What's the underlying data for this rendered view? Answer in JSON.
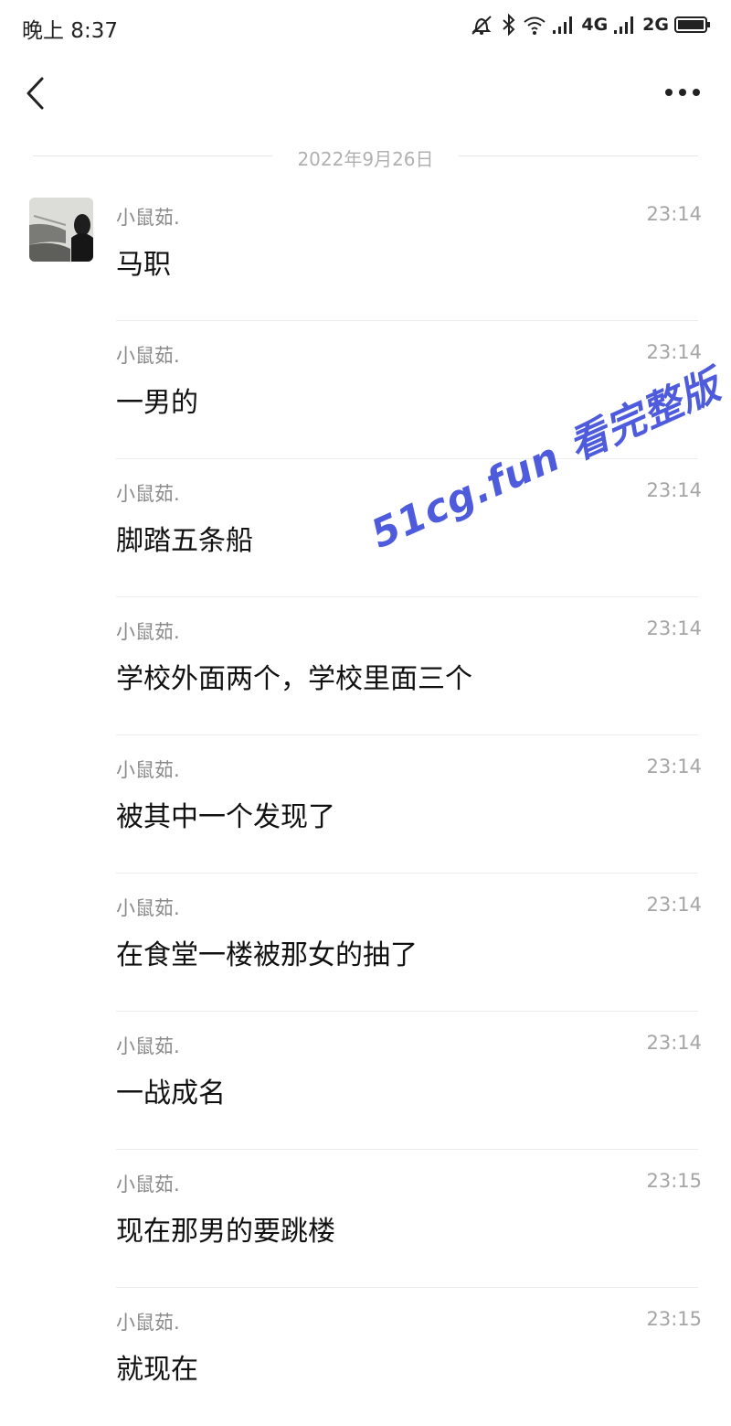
{
  "status_bar": {
    "time": "晚上 8:37",
    "network_1": "4G",
    "network_2": "2G",
    "icons": [
      "mute-icon",
      "bluetooth-icon",
      "wifi-icon",
      "signal-icon",
      "signal-icon",
      "battery-icon"
    ]
  },
  "nav": {
    "back_icon": "chevron-left-icon",
    "more_icon": "more-dots-icon"
  },
  "date_divider": "2022年9月26日",
  "messages": [
    {
      "sender": "小鼠茹.",
      "time": "23:14",
      "text": "马职"
    },
    {
      "sender": "小鼠茹.",
      "time": "23:14",
      "text": "一男的"
    },
    {
      "sender": "小鼠茹.",
      "time": "23:14",
      "text": "脚踏五条船"
    },
    {
      "sender": "小鼠茹.",
      "time": "23:14",
      "text": "学校外面两个，学校里面三个"
    },
    {
      "sender": "小鼠茹.",
      "time": "23:14",
      "text": "被其中一个发现了"
    },
    {
      "sender": "小鼠茹.",
      "time": "23:14",
      "text": "在食堂一楼被那女的抽了"
    },
    {
      "sender": "小鼠茹.",
      "time": "23:14",
      "text": "一战成名"
    },
    {
      "sender": "小鼠茹.",
      "time": "23:15",
      "text": "现在那男的要跳楼"
    },
    {
      "sender": "小鼠茹.",
      "time": "23:15",
      "text": "就现在"
    }
  ],
  "watermark": "51cg.fun 看完整版",
  "colors": {
    "watermark": "#2f3fd6",
    "meta_text": "#8a8a8a",
    "separator": "#ebebeb"
  }
}
